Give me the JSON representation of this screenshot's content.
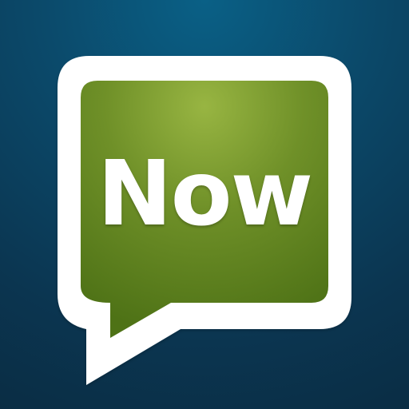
{
  "icon": {
    "text": "Now",
    "name": "speech-bubble-icon"
  },
  "colors": {
    "background_top": "#0a6086",
    "background_bottom": "#0a2d44",
    "bubble_border": "#ffffff",
    "bubble_fill_light": "#98b542",
    "bubble_fill_dark": "#4e7216",
    "text": "#ffffff"
  }
}
